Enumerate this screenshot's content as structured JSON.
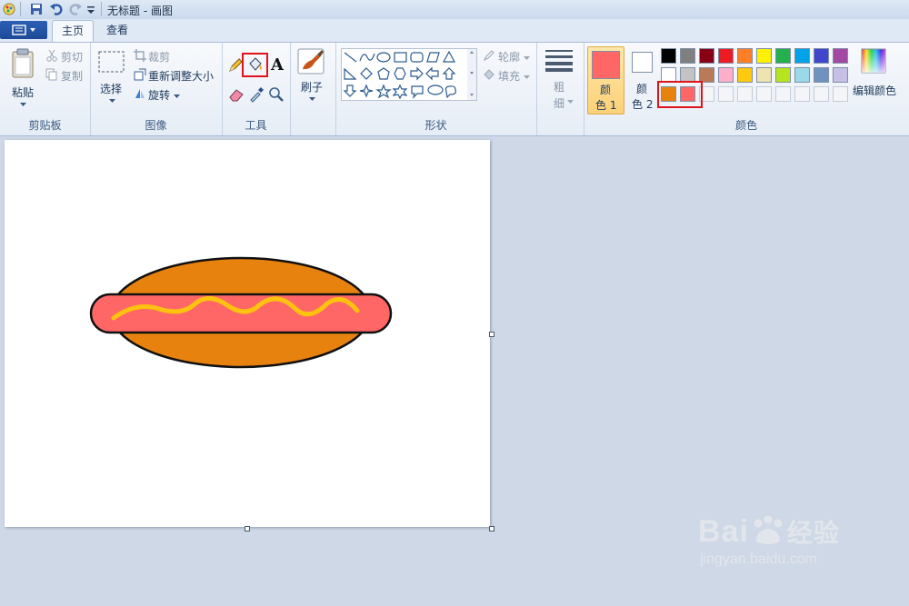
{
  "window": {
    "title": "无标题 - 画图"
  },
  "tabs": [
    {
      "label": "主页"
    },
    {
      "label": "查看"
    }
  ],
  "clipboard": {
    "paste": "粘贴",
    "cut": "剪切",
    "copy": "复制",
    "group": "剪贴板"
  },
  "image": {
    "select": "选择",
    "crop": "裁剪",
    "resize": "重新调整大小",
    "rotate": "旋转",
    "group": "图像"
  },
  "tools": {
    "group": "工具",
    "text_glyph": "A"
  },
  "brushes": {
    "label": "刷子"
  },
  "shapes": {
    "outline": "轮廓",
    "fill": "填充",
    "group": "形状"
  },
  "size": {
    "label_top": "粗",
    "label_bottom": "细"
  },
  "colors": {
    "color1_top": "颜",
    "color1_bottom": "色 1",
    "color2_top": "颜",
    "color2_bottom": "色 2",
    "edit": "编辑颜色",
    "group": "颜色",
    "color1_value": "#ff6666",
    "color2_value": "#ffffff",
    "row1": [
      "#000000",
      "#7f7f7f",
      "#880015",
      "#ed1c24",
      "#ff7f27",
      "#fff200",
      "#22b14c",
      "#00a2e8",
      "#3f48cc",
      "#a349a4"
    ],
    "row2": [
      "#ffffff",
      "#c3c3c3",
      "#b97a57",
      "#ffaec9",
      "#ffc90e",
      "#efe4b0",
      "#b5e61d",
      "#99d9ea",
      "#7092be",
      "#c8bfe7"
    ],
    "custom": [
      "#e8820e",
      "#ff6666"
    ]
  },
  "drawing": {
    "bun_color": "#e8820e",
    "sausage_color": "#ff6666",
    "mustard_color": "#ffc20e"
  },
  "watermark": {
    "brand": "Bai",
    "brand_cn": "经验",
    "url": "jingyan.baidu.com"
  }
}
